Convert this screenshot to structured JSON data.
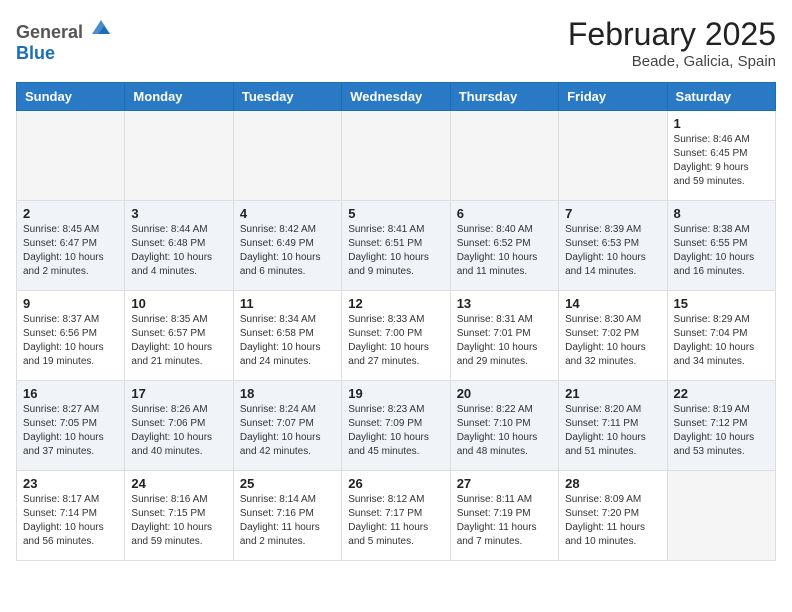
{
  "logo": {
    "general": "General",
    "blue": "Blue"
  },
  "title": {
    "month": "February 2025",
    "location": "Beade, Galicia, Spain"
  },
  "weekdays": [
    "Sunday",
    "Monday",
    "Tuesday",
    "Wednesday",
    "Thursday",
    "Friday",
    "Saturday"
  ],
  "weeks": [
    [
      {
        "day": "",
        "info": ""
      },
      {
        "day": "",
        "info": ""
      },
      {
        "day": "",
        "info": ""
      },
      {
        "day": "",
        "info": ""
      },
      {
        "day": "",
        "info": ""
      },
      {
        "day": "",
        "info": ""
      },
      {
        "day": "1",
        "info": "Sunrise: 8:46 AM\nSunset: 6:45 PM\nDaylight: 9 hours\nand 59 minutes."
      }
    ],
    [
      {
        "day": "2",
        "info": "Sunrise: 8:45 AM\nSunset: 6:47 PM\nDaylight: 10 hours\nand 2 minutes."
      },
      {
        "day": "3",
        "info": "Sunrise: 8:44 AM\nSunset: 6:48 PM\nDaylight: 10 hours\nand 4 minutes."
      },
      {
        "day": "4",
        "info": "Sunrise: 8:42 AM\nSunset: 6:49 PM\nDaylight: 10 hours\nand 6 minutes."
      },
      {
        "day": "5",
        "info": "Sunrise: 8:41 AM\nSunset: 6:51 PM\nDaylight: 10 hours\nand 9 minutes."
      },
      {
        "day": "6",
        "info": "Sunrise: 8:40 AM\nSunset: 6:52 PM\nDaylight: 10 hours\nand 11 minutes."
      },
      {
        "day": "7",
        "info": "Sunrise: 8:39 AM\nSunset: 6:53 PM\nDaylight: 10 hours\nand 14 minutes."
      },
      {
        "day": "8",
        "info": "Sunrise: 8:38 AM\nSunset: 6:55 PM\nDaylight: 10 hours\nand 16 minutes."
      }
    ],
    [
      {
        "day": "9",
        "info": "Sunrise: 8:37 AM\nSunset: 6:56 PM\nDaylight: 10 hours\nand 19 minutes."
      },
      {
        "day": "10",
        "info": "Sunrise: 8:35 AM\nSunset: 6:57 PM\nDaylight: 10 hours\nand 21 minutes."
      },
      {
        "day": "11",
        "info": "Sunrise: 8:34 AM\nSunset: 6:58 PM\nDaylight: 10 hours\nand 24 minutes."
      },
      {
        "day": "12",
        "info": "Sunrise: 8:33 AM\nSunset: 7:00 PM\nDaylight: 10 hours\nand 27 minutes."
      },
      {
        "day": "13",
        "info": "Sunrise: 8:31 AM\nSunset: 7:01 PM\nDaylight: 10 hours\nand 29 minutes."
      },
      {
        "day": "14",
        "info": "Sunrise: 8:30 AM\nSunset: 7:02 PM\nDaylight: 10 hours\nand 32 minutes."
      },
      {
        "day": "15",
        "info": "Sunrise: 8:29 AM\nSunset: 7:04 PM\nDaylight: 10 hours\nand 34 minutes."
      }
    ],
    [
      {
        "day": "16",
        "info": "Sunrise: 8:27 AM\nSunset: 7:05 PM\nDaylight: 10 hours\nand 37 minutes."
      },
      {
        "day": "17",
        "info": "Sunrise: 8:26 AM\nSunset: 7:06 PM\nDaylight: 10 hours\nand 40 minutes."
      },
      {
        "day": "18",
        "info": "Sunrise: 8:24 AM\nSunset: 7:07 PM\nDaylight: 10 hours\nand 42 minutes."
      },
      {
        "day": "19",
        "info": "Sunrise: 8:23 AM\nSunset: 7:09 PM\nDaylight: 10 hours\nand 45 minutes."
      },
      {
        "day": "20",
        "info": "Sunrise: 8:22 AM\nSunset: 7:10 PM\nDaylight: 10 hours\nand 48 minutes."
      },
      {
        "day": "21",
        "info": "Sunrise: 8:20 AM\nSunset: 7:11 PM\nDaylight: 10 hours\nand 51 minutes."
      },
      {
        "day": "22",
        "info": "Sunrise: 8:19 AM\nSunset: 7:12 PM\nDaylight: 10 hours\nand 53 minutes."
      }
    ],
    [
      {
        "day": "23",
        "info": "Sunrise: 8:17 AM\nSunset: 7:14 PM\nDaylight: 10 hours\nand 56 minutes."
      },
      {
        "day": "24",
        "info": "Sunrise: 8:16 AM\nSunset: 7:15 PM\nDaylight: 10 hours\nand 59 minutes."
      },
      {
        "day": "25",
        "info": "Sunrise: 8:14 AM\nSunset: 7:16 PM\nDaylight: 11 hours\nand 2 minutes."
      },
      {
        "day": "26",
        "info": "Sunrise: 8:12 AM\nSunset: 7:17 PM\nDaylight: 11 hours\nand 5 minutes."
      },
      {
        "day": "27",
        "info": "Sunrise: 8:11 AM\nSunset: 7:19 PM\nDaylight: 11 hours\nand 7 minutes."
      },
      {
        "day": "28",
        "info": "Sunrise: 8:09 AM\nSunset: 7:20 PM\nDaylight: 11 hours\nand 10 minutes."
      },
      {
        "day": "",
        "info": ""
      }
    ]
  ]
}
